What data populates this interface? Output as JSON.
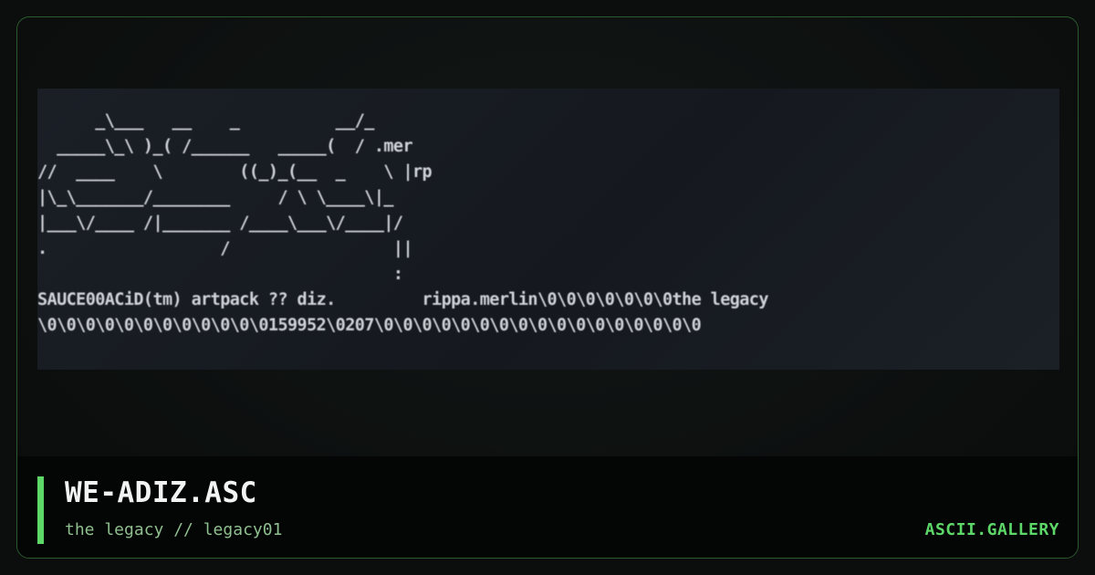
{
  "art": {
    "lines": [
      "      _\\___   __    _          __/_",
      "  _____\\_\\ )_( /______   _____(  / .mer",
      "//  ____    \\        ((_)_(__  _    \\ |rp",
      "|\\_\\_______/________     / \\ \\____\\|_",
      "|___\\/____ /|_______ /____\\___\\/____|/",
      ".                  /                 ||",
      "                                     :",
      "SAUCE00ACiD(tm) artpack ?? diz.         rippa.merlin\\0\\0\\0\\0\\0\\0\\0the legacy",
      "\\0\\0\\0\\0\\0\\0\\0\\0\\0\\0\\0\\0159952\\0207\\0\\0\\0\\0\\0\\0\\0\\0\\0\\0\\0\\0\\0\\0\\0\\0\\0"
    ]
  },
  "footer": {
    "title": "WE-ADIZ.ASC",
    "subtitle": "the legacy // legacy01",
    "brand": "ASCII.GALLERY"
  },
  "colors": {
    "accent": "#5dd868",
    "border": "#2c5a2e",
    "background": "#0b0e0d",
    "footer_bg": "#040505"
  }
}
